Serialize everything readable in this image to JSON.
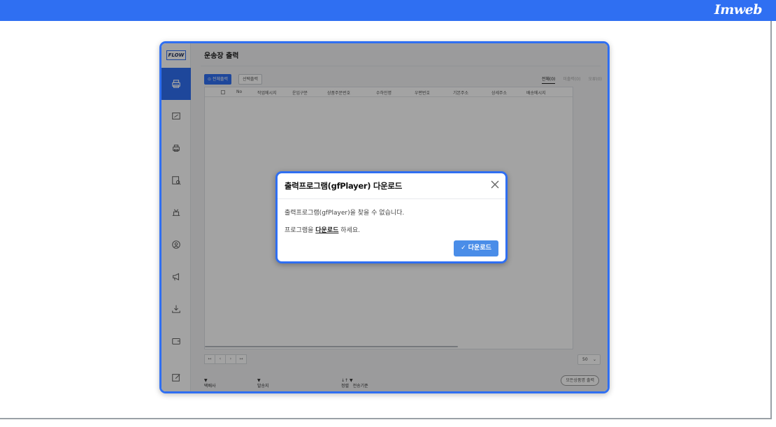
{
  "brand": "Imweb",
  "app": {
    "logo": "FLOW",
    "page_title": "운송장 출력",
    "sidebar_icons": [
      "printer-icon",
      "invoice-icon",
      "print-list-icon",
      "order-search-icon",
      "tray-icon",
      "user-circle-icon",
      "megaphone-icon",
      "download-icon",
      "wallet-icon",
      "edit-icon"
    ]
  },
  "toolbar": {
    "print_all_label": "⊙ 전체출력",
    "print_selected_label": "선택출력"
  },
  "tabs": [
    {
      "label": "전체(0)",
      "active": true
    },
    {
      "label": "미출력(0)",
      "active": false
    },
    {
      "label": "오류(0)",
      "active": false
    }
  ],
  "table": {
    "columns": [
      "No",
      "작업메시지",
      "운임구분",
      "상품주문번호",
      "수하인명",
      "우편번호",
      "기본주소",
      "상세주소",
      "배송메시지"
    ],
    "rows": []
  },
  "pager": {
    "buttons": [
      "↤",
      "‹",
      "›",
      "↦"
    ],
    "per_page": "50"
  },
  "footer": {
    "carrier_label": "택배사",
    "sender_label": "발송지",
    "sort_label": "정렬",
    "sort_basis": "전송기준",
    "print_all_button": "모든상품명 출력"
  },
  "modal": {
    "title": "출력프로그램(gfPlayer) 다운로드",
    "message1": "출력프로그램(gfPlayer)을 찾을 수 없습니다.",
    "message2_prefix": "프로그램을",
    "message2_link": "다운로드",
    "message2_suffix": "하세요.",
    "download_button": "✓ 다운로드"
  }
}
